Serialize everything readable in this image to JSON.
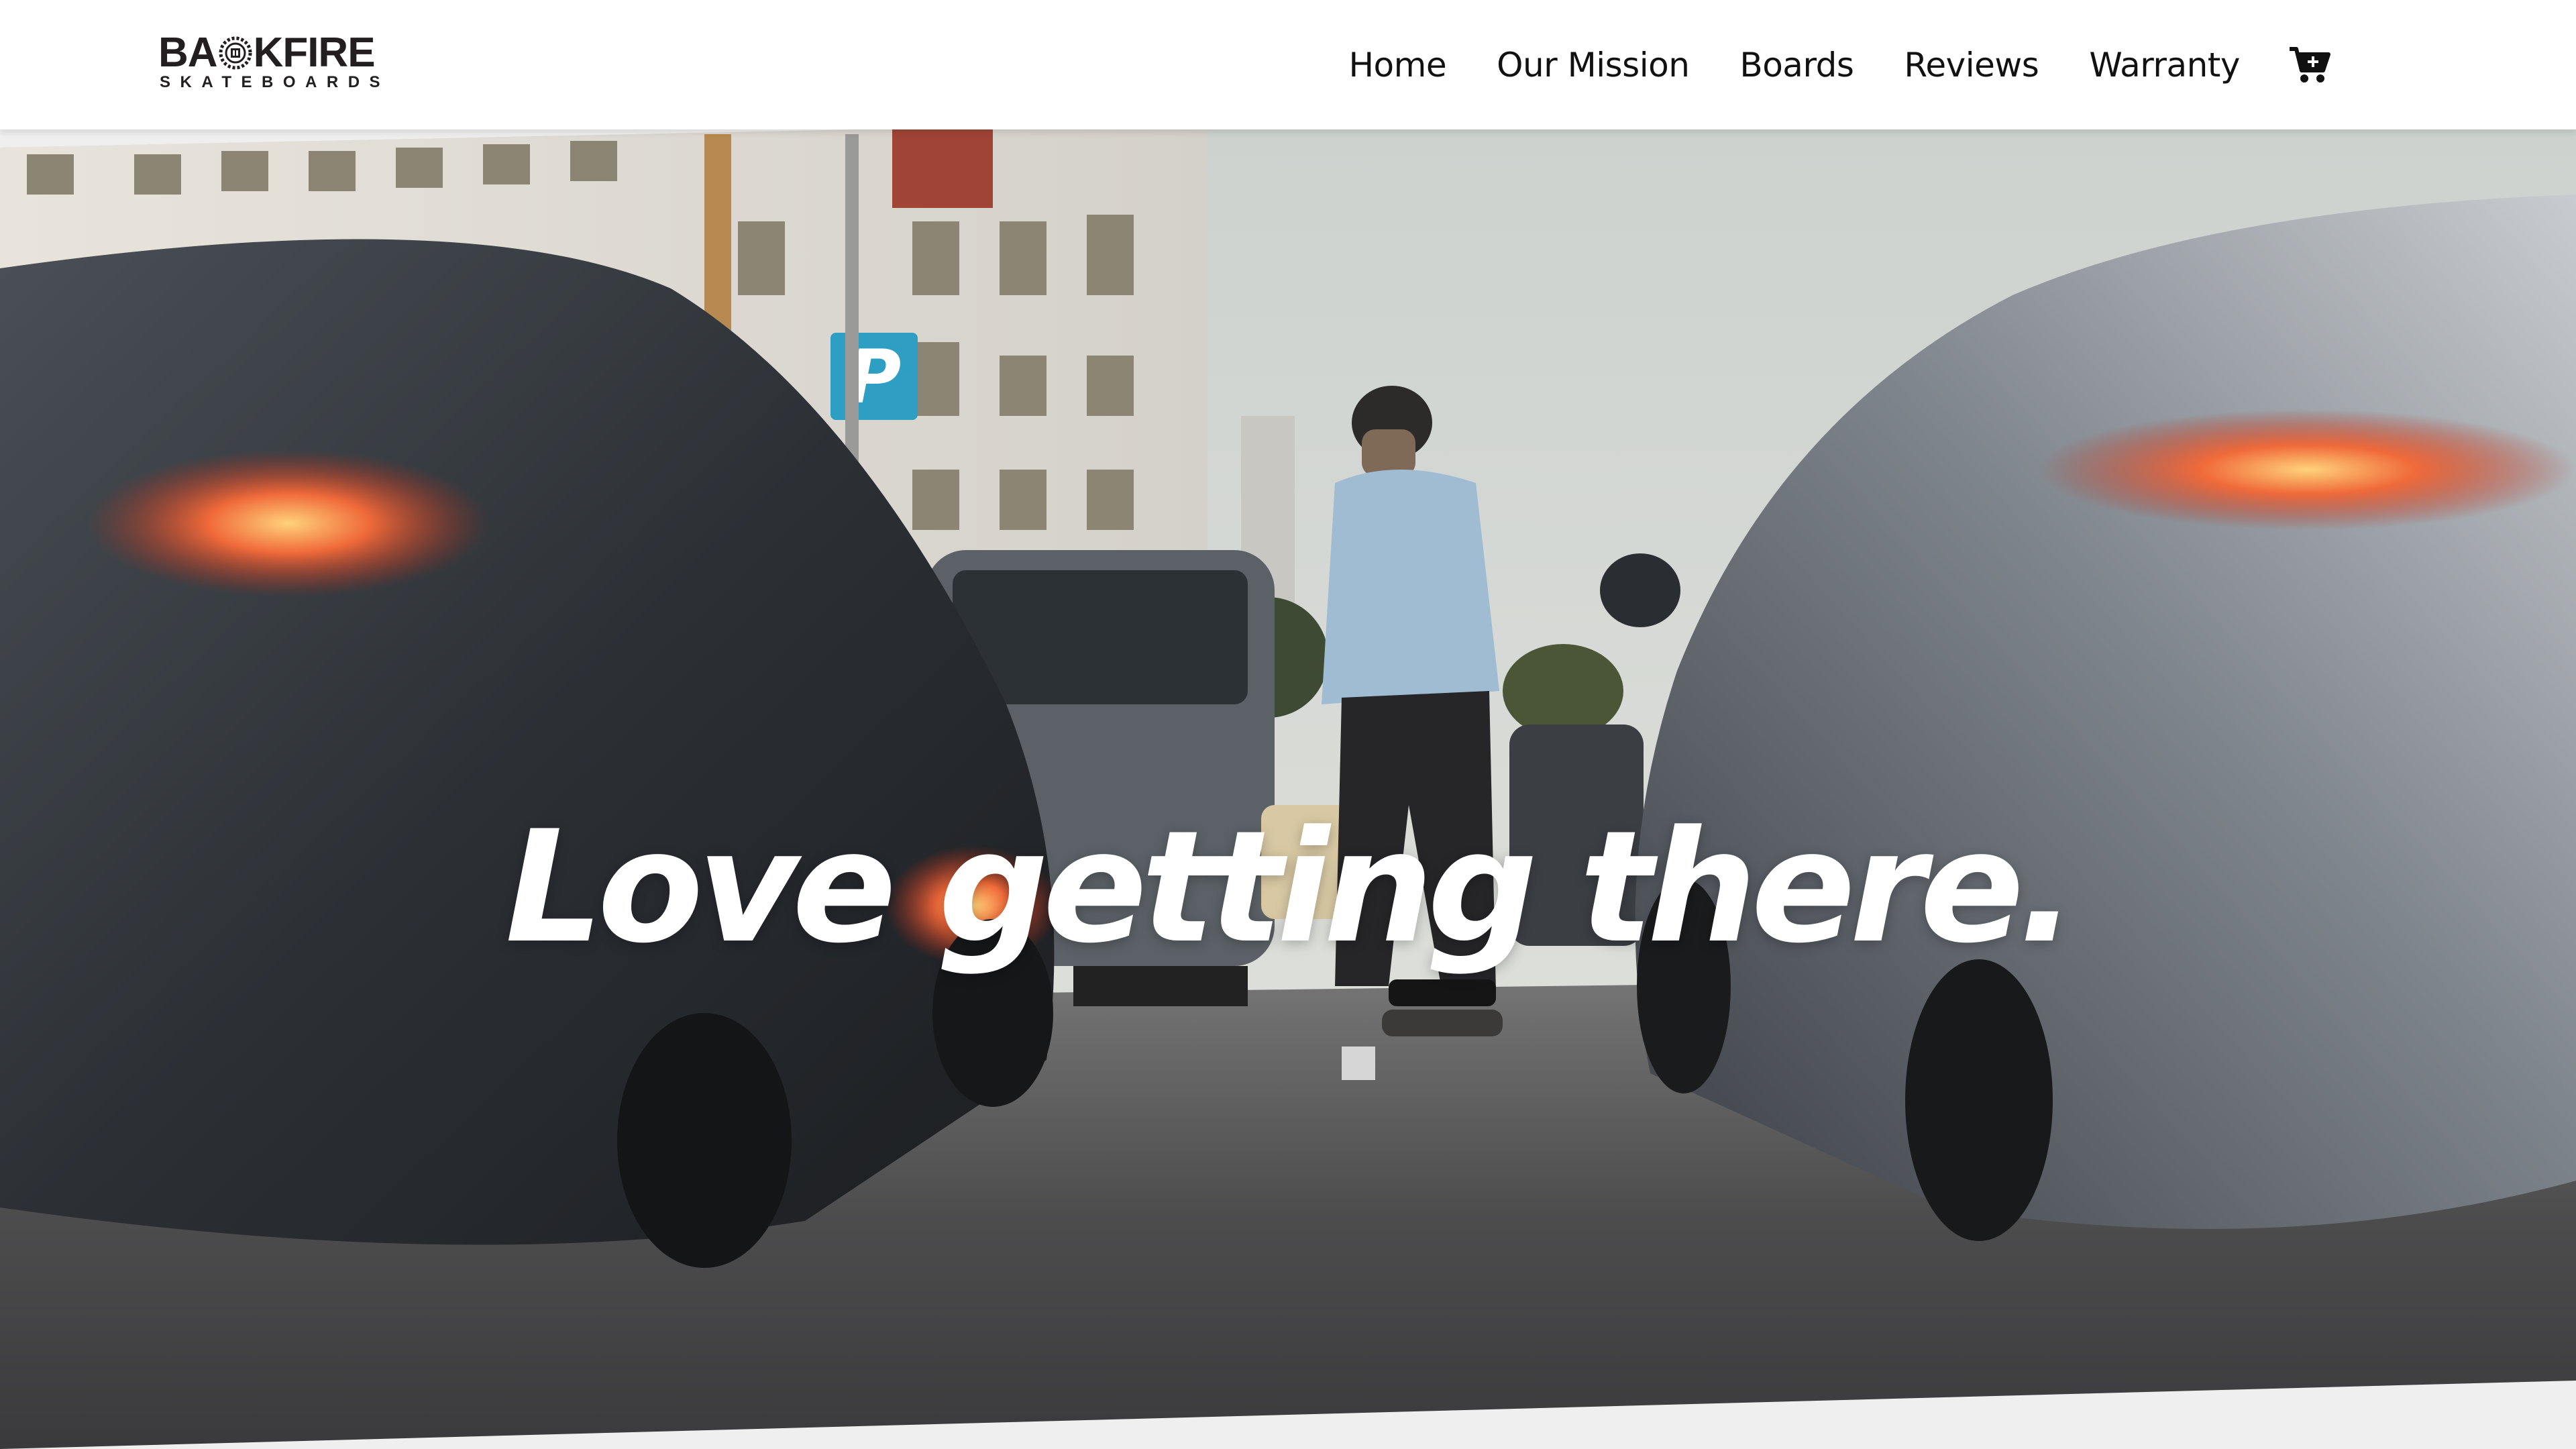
{
  "brand": {
    "name": "BACKFIRE",
    "name_left": "BA",
    "name_right": "KFIRE",
    "tagline": "SKATEBOARDS"
  },
  "nav": {
    "items": [
      {
        "label": "Home"
      },
      {
        "label": "Our Mission"
      },
      {
        "label": "Boards"
      },
      {
        "label": "Reviews"
      },
      {
        "label": "Warranty"
      }
    ],
    "cart_icon": "shopping-cart-icon"
  },
  "hero": {
    "headline": "Love getting there.",
    "image_subject": "skateboarder riding between lanes of traffic",
    "parking_sign": "P"
  },
  "colors": {
    "header_bg": "#ffffff",
    "text_dark": "#111111",
    "headline": "#ffffff",
    "page_bg": "#efefef",
    "taillight": "#e8452a"
  }
}
